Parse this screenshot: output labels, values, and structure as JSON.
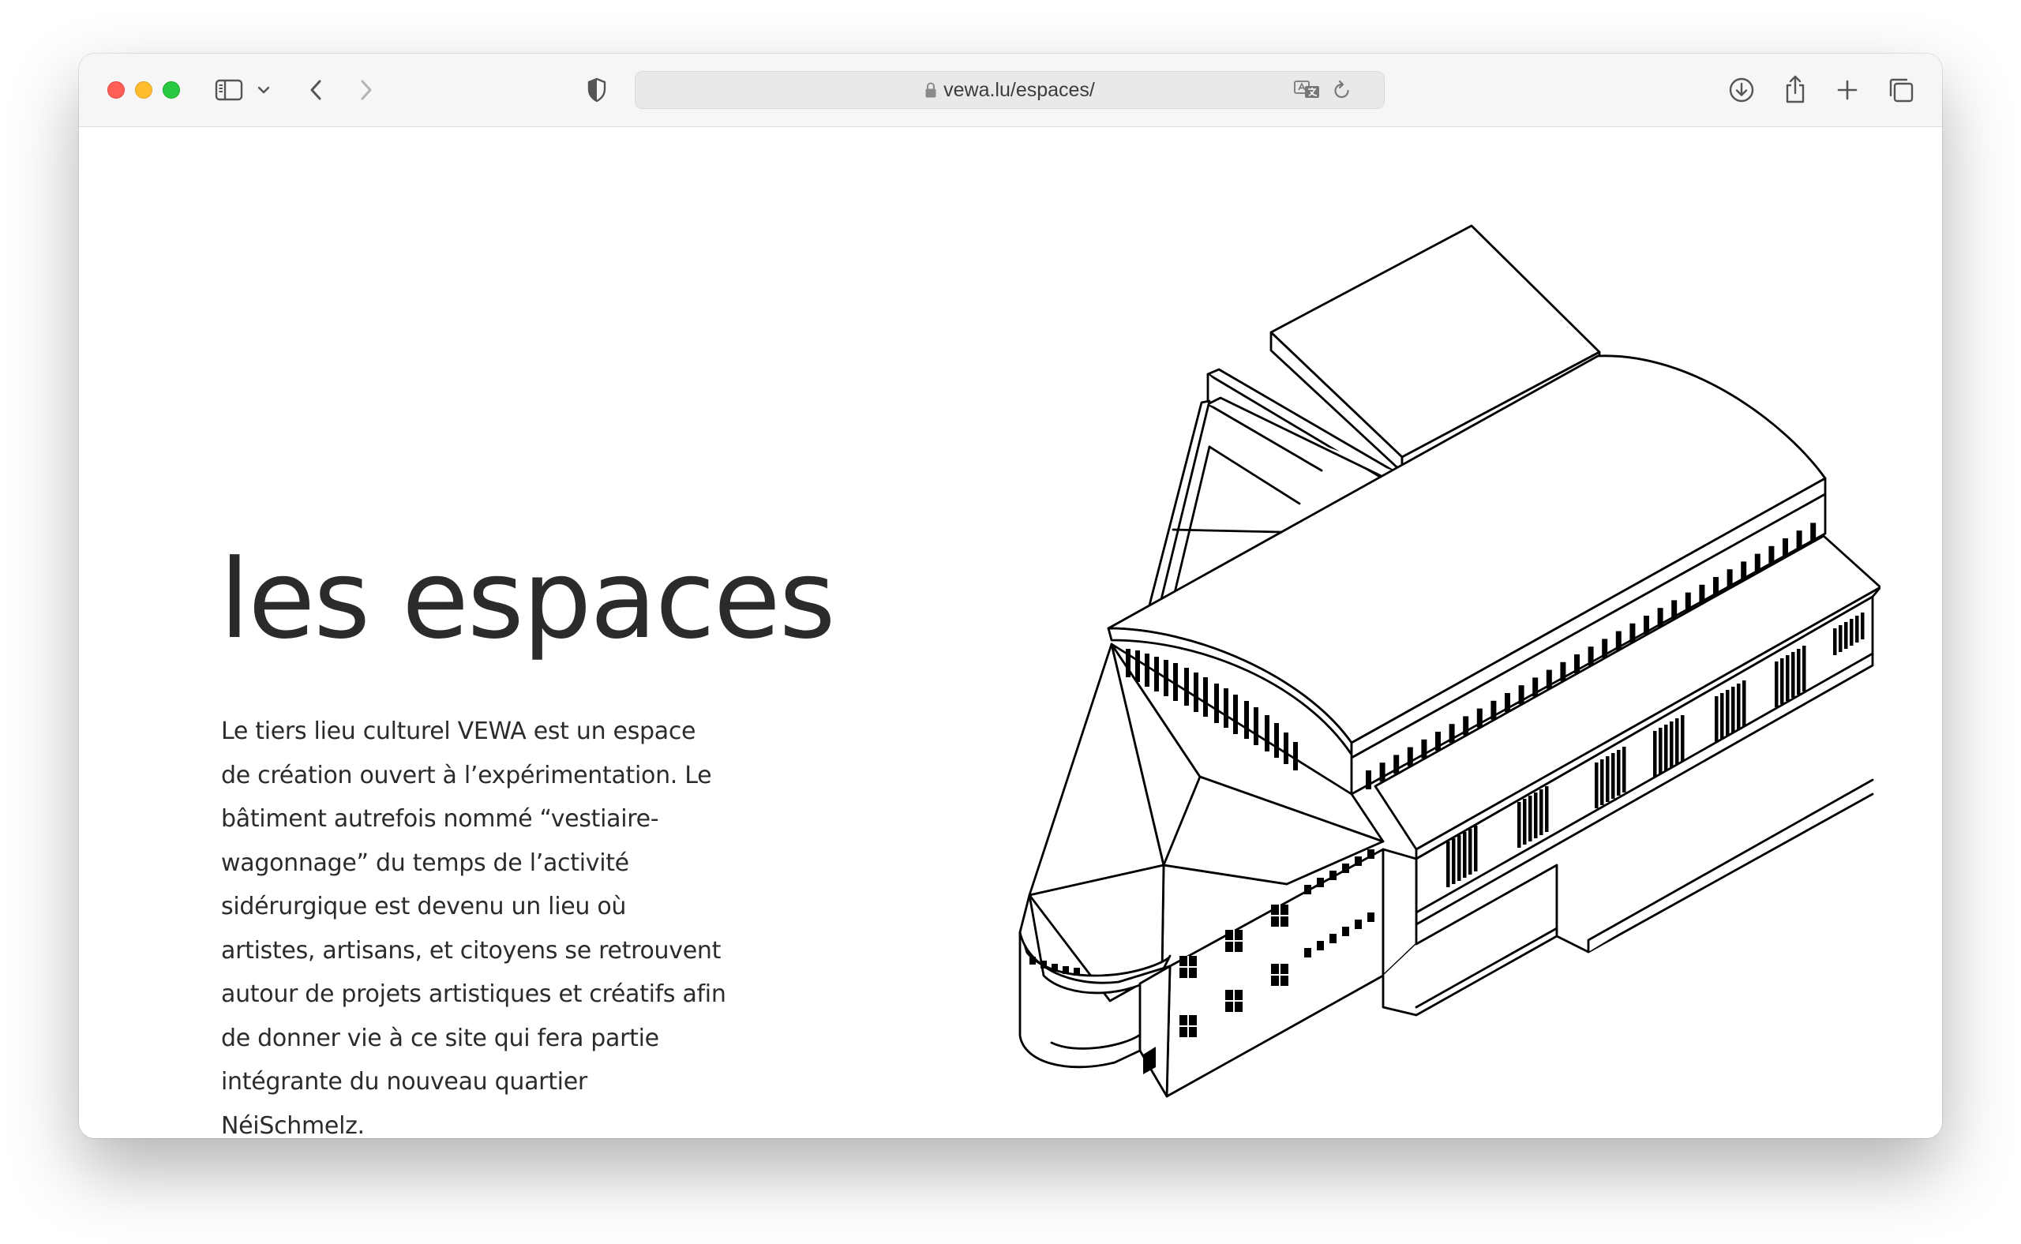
{
  "browser": {
    "url": "vewa.lu/espaces/",
    "traffic_lights": {
      "close": "#ff5f57",
      "minimize": "#febc2e",
      "zoom": "#28c840"
    },
    "toolbar_icons": [
      "sidebar-icon",
      "chevron-down-icon",
      "back-icon",
      "forward-icon",
      "privacy-shield-icon",
      "lock-icon",
      "translate-icon",
      "reload-icon",
      "download-icon",
      "share-icon",
      "new-tab-icon",
      "tab-overview-icon"
    ]
  },
  "page": {
    "title": "les espaces",
    "description": "Le tiers lieu culturel VEWA est un espace de création ouvert à l’expérimentation. Le bâtiment autrefois nommé “vestiaire-wagonnage” du temps de l’activité sidérurgique est devenu un lieu où artistes, artisans, et citoyens se retrouvent autour de projets artistiques et créatifs afin de donner vie à ce site qui fera partie intégrante du nouveau quartier NéiSchmelz.",
    "illustration": "isometric-building-illustration",
    "colors": {
      "text": "#2b2b2b",
      "line": "#000000",
      "background": "#ffffff"
    }
  }
}
